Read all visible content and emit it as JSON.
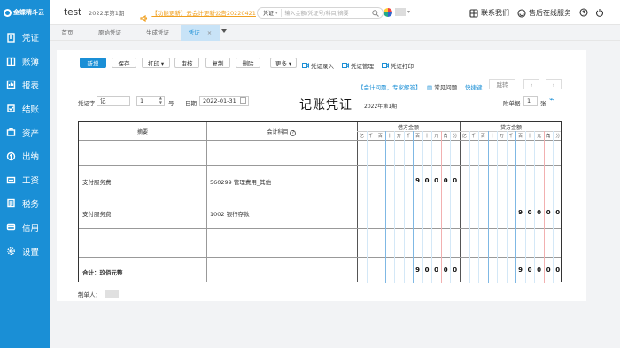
{
  "app": {
    "logo_text": "金蝶精斗云",
    "company": "test",
    "period": "2022年第1期",
    "notice": "【功能更新】云会计更新公告20220421"
  },
  "sidebar": {
    "items": [
      {
        "label": "凭证",
        "icon": "voucher-icon"
      },
      {
        "label": "账簿",
        "icon": "book-icon"
      },
      {
        "label": "报表",
        "icon": "report-icon"
      },
      {
        "label": "结账",
        "icon": "closing-icon"
      },
      {
        "label": "资产",
        "icon": "asset-icon"
      },
      {
        "label": "出纳",
        "icon": "cashier-icon"
      },
      {
        "label": "工资",
        "icon": "salary-icon"
      },
      {
        "label": "税务",
        "icon": "tax-icon"
      },
      {
        "label": "信用",
        "icon": "credit-icon"
      },
      {
        "label": "设置",
        "icon": "settings-icon"
      }
    ]
  },
  "search": {
    "scope": "凭证",
    "placeholder": "输入金额/凭证号/科目/摘要"
  },
  "header": {
    "contact": "联系我们",
    "service": "售后在线服务"
  },
  "tabs": [
    {
      "label": "首页"
    },
    {
      "label": "原始凭证"
    },
    {
      "label": "生成凭证"
    },
    {
      "label": "凭证",
      "active": true
    }
  ],
  "toolbar": {
    "new": "新增",
    "save": "保存",
    "print": "打印",
    "audit": "审核",
    "copy": "复制",
    "delete": "删除",
    "more": "更多",
    "entry": "凭证录入",
    "manage": "凭证管理",
    "vprint": "凭证打印"
  },
  "links": {
    "help": "【会计问题，专家解答】",
    "faq": "常见问题",
    "shortcut": "快捷键",
    "jump": "跳转"
  },
  "voucher": {
    "word_label": "凭证字",
    "word": "记",
    "number": "1",
    "number_suffix": "号",
    "date_label": "日期",
    "date": "2022-01-31",
    "title": "记账凭证",
    "period": "2022年第1期",
    "attach_label": "附单据",
    "attach": "1",
    "attach_suffix": "张",
    "col_summary": "摘要",
    "col_account": "会计科目",
    "col_debit": "借方金额",
    "col_credit": "贷方金额",
    "units": [
      "亿",
      "千",
      "百",
      "十",
      "万",
      "千",
      "百",
      "十",
      "元",
      "角",
      "分"
    ],
    "rows": [
      {
        "summary": "支付服务费",
        "account": "560299 管理费用_其他",
        "debit": "90000",
        "credit": ""
      },
      {
        "summary": "支付服务费",
        "account": "1002 银行存款",
        "debit": "",
        "credit": "90000"
      },
      {
        "summary": "",
        "account": "",
        "debit": "",
        "credit": ""
      },
      {
        "summary": "",
        "account": "",
        "debit": "",
        "credit": ""
      }
    ],
    "total_label": "合计：玖佰元整",
    "total_debit": "90000",
    "total_credit": "90000",
    "maker_label": "制单人："
  }
}
